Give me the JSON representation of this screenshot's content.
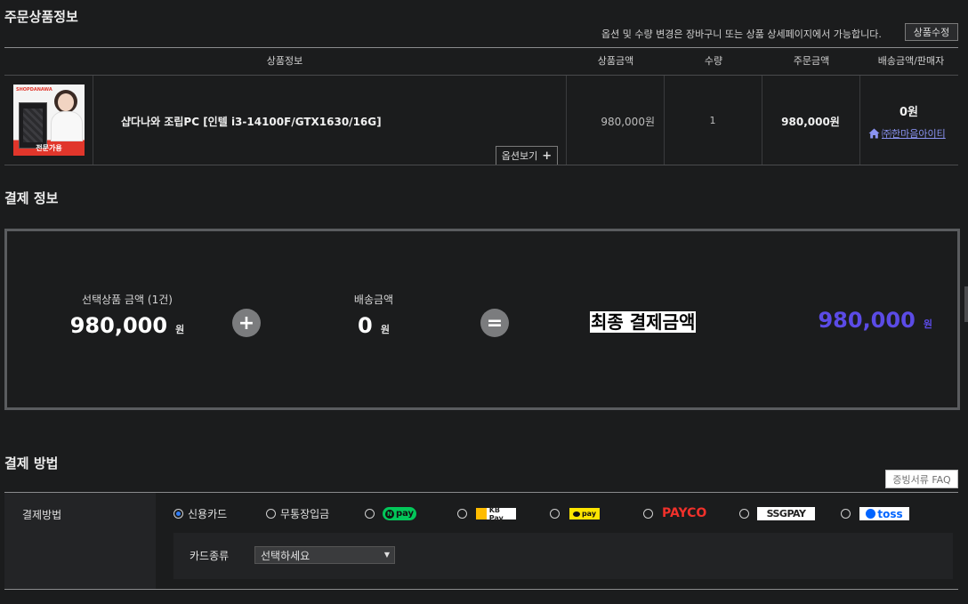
{
  "order": {
    "section_title": "주문상품정보",
    "notice": "옵션 및 수량 변경은 장바구니 또는 상품 상세페이지에서 가능합니다.",
    "edit_button": "상품수정",
    "columns": [
      "상품정보",
      "상품금액",
      "수량",
      "주문금액",
      "배송금액/판매자"
    ],
    "item": {
      "thumb_brand": "SHOPDANAWA",
      "thumb_badge": "전문가용",
      "name": "샵다나와 조립PC [인텔 i3-14100F/GTX1630/16G]",
      "option_button": "옵션보기",
      "price": "980,000원",
      "qty": "1",
      "order_amount": "980,000원",
      "shipping": "0원",
      "seller": "㈜한마음아이티"
    }
  },
  "payment_info": {
    "section_title": "결제 정보",
    "selected_label": "선택상품 금액 (1건)",
    "selected_amount": "980,000",
    "won": "원",
    "shipping_label": "배송금액",
    "shipping_amount": "0",
    "plus": "+",
    "equals": "=",
    "final_label": "최종 결제금액",
    "final_amount": "980,000"
  },
  "payment_method": {
    "section_title": "결제 방법",
    "faq_button": "증빙서류 FAQ",
    "row_label": "결제방법",
    "options": [
      "신용카드",
      "무통장입금",
      "pay",
      "KB Pay",
      "pay",
      "PAYCO",
      "SSGPAY",
      "toss"
    ],
    "selected": "신용카드",
    "card_type_label": "카드종류",
    "card_select_value": "선택하세요"
  },
  "colors": {
    "accent_purple": "#5b4be6",
    "payco_red": "#f0312b",
    "npay_green": "#03c75a",
    "toss_blue": "#0064ff",
    "kakao_yellow": "#fee500"
  }
}
